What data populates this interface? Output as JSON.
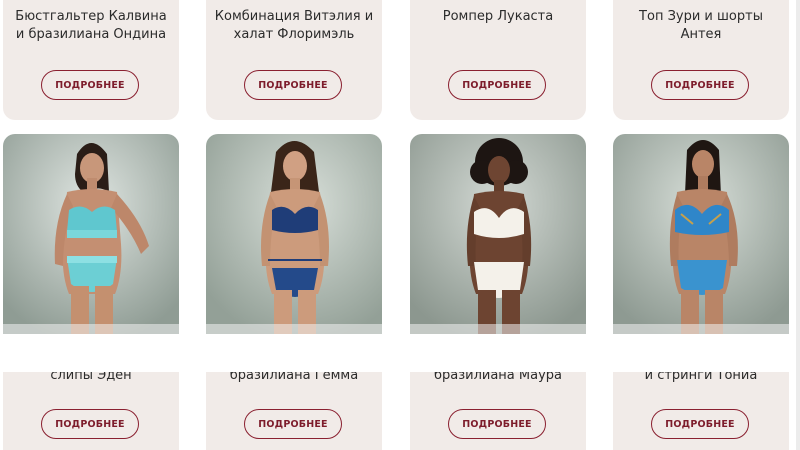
{
  "products": [
    {
      "top_title": "Бюстгальтер Калвина и бразилиана Ондина",
      "top_button": "ПОДРОБНЕЕ",
      "bottom_title": "слипы Эден",
      "bottom_button": "ПОДРОБНЕЕ"
    },
    {
      "top_title": "Комбинация Витэлия и халат Флоримэль",
      "top_button": "ПОДРОБНЕЕ",
      "bottom_title": "бразилиана Гемма",
      "bottom_button": "ПОДРОБНЕЕ"
    },
    {
      "top_title": "Ромпер Лукаста",
      "top_button": "ПОДРОБНЕЕ",
      "bottom_title": "бразилиана Маура",
      "bottom_button": "ПОДРОБНЕЕ"
    },
    {
      "top_title": "Топ Зури и шорты Антея",
      "top_button": "ПОДРОБНЕЕ",
      "bottom_title": "и стринги Тониа",
      "bottom_button": "ПОДРОБНЕЕ"
    }
  ],
  "colors": {
    "card_background": "#f1ebe8",
    "button_border": "#8a2030",
    "button_text": "#7d1c2b",
    "photo_background": "#9aa79f"
  },
  "photo_subjects": [
    "model-in-aqua-lingerie",
    "model-in-navy-lace-lingerie",
    "model-in-white-lingerie",
    "model-in-blue-lace-lingerie"
  ]
}
